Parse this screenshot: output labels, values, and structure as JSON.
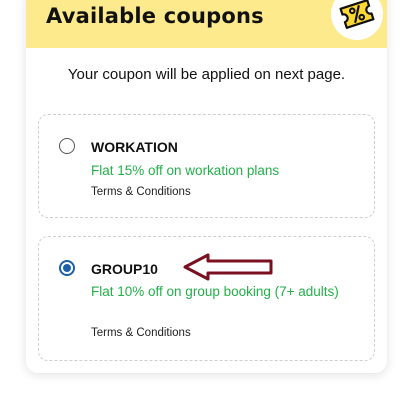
{
  "header": {
    "title": "Available coupons",
    "icon": "coupon-ticket-icon",
    "accent": "#fdea8c"
  },
  "subtitle": "Your coupon will be applied on next page.",
  "coupons": [
    {
      "code": "WORKATION",
      "offer": "Flat 15% off on workation plans",
      "terms": "Terms & Conditions",
      "selected": false
    },
    {
      "code": "GROUP10",
      "offer": "Flat 10% off on group booking (7+ adults)",
      "terms": "Terms & Conditions",
      "selected": true
    }
  ],
  "colors": {
    "offer_green": "#23b04a",
    "radio_blue": "#1a5fa8",
    "annotation_arrow": "#7a0f1f"
  }
}
